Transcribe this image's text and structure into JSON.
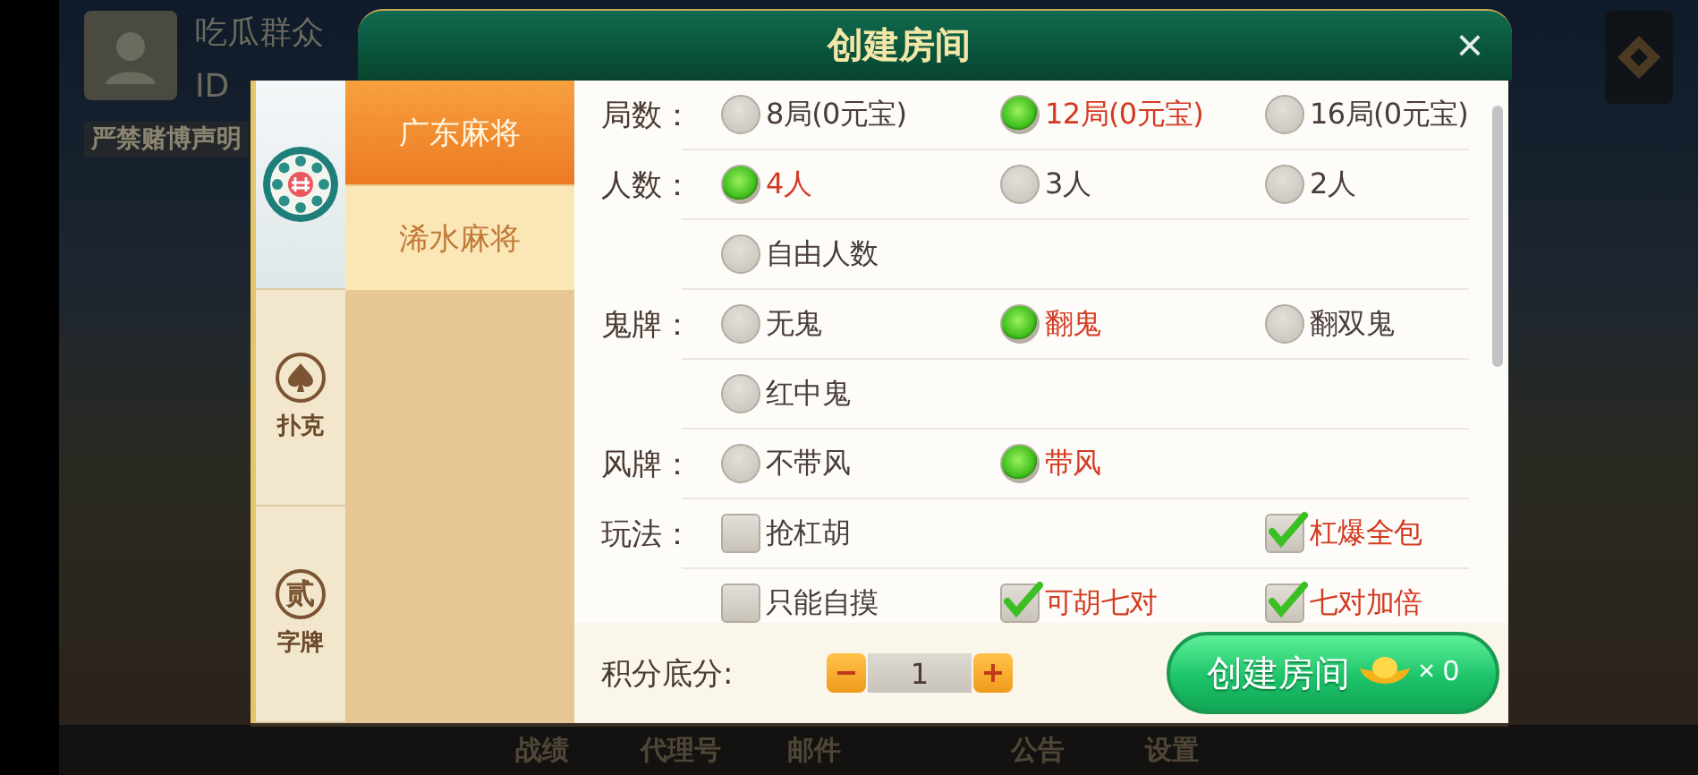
{
  "background": {
    "player": {
      "name": "吃瓜群众",
      "id": "ID"
    },
    "notice": "严禁赌博声明",
    "nav": [
      "战绩",
      "代理号",
      "邮件",
      "公告",
      "设置"
    ]
  },
  "dialog": {
    "title": "创建房间",
    "close": "×",
    "categories": [
      {
        "kind": "mahjong",
        "selected": true
      },
      {
        "kind": "poker",
        "label": "扑克",
        "selected": false
      },
      {
        "kind": "zipai",
        "glyph": "贰",
        "label": "字牌",
        "selected": false
      }
    ],
    "games": [
      {
        "label": "广东麻将",
        "selected": true
      },
      {
        "label": "浠水麻将",
        "selected": false
      }
    ],
    "rules": [
      {
        "label": "局数：",
        "kind": "radio",
        "options": [
          {
            "text": "8局(0元宝)",
            "selected": false
          },
          {
            "text": "12局(0元宝)",
            "selected": true
          },
          {
            "text": "16局(0元宝)",
            "selected": false
          }
        ]
      },
      {
        "label": "人数：",
        "kind": "radio",
        "options": [
          {
            "text": "4人",
            "selected": true
          },
          {
            "text": "3人",
            "selected": false
          },
          {
            "text": "2人",
            "selected": false
          }
        ]
      },
      {
        "kind": "radio",
        "options": [
          {
            "text": "自由人数",
            "selected": false
          }
        ]
      },
      {
        "label": "鬼牌：",
        "kind": "radio",
        "options": [
          {
            "text": "无鬼",
            "selected": false
          },
          {
            "text": "翻鬼",
            "selected": true
          },
          {
            "text": "翻双鬼",
            "selected": false
          }
        ]
      },
      {
        "kind": "radio",
        "options": [
          {
            "text": "红中鬼",
            "selected": false
          }
        ]
      },
      {
        "label": "风牌：",
        "kind": "radio",
        "options": [
          {
            "text": "不带风",
            "selected": false
          },
          {
            "text": "带风",
            "selected": true
          }
        ]
      },
      {
        "label": "玩法：",
        "kind": "checkbox",
        "options": [
          {
            "text": "抢杠胡",
            "checked": false
          },
          {
            "kind": "blank"
          },
          {
            "text": "杠爆全包",
            "checked": true
          }
        ]
      },
      {
        "kind": "checkbox",
        "options": [
          {
            "text": "只能自摸",
            "checked": false
          },
          {
            "text": "可胡七对",
            "checked": true
          },
          {
            "text": "七对加倍",
            "checked": true
          }
        ]
      }
    ],
    "score": {
      "label": "积分底分:",
      "value": "1"
    },
    "create_button": {
      "label": "创建房间",
      "cost": "× 0"
    }
  }
}
